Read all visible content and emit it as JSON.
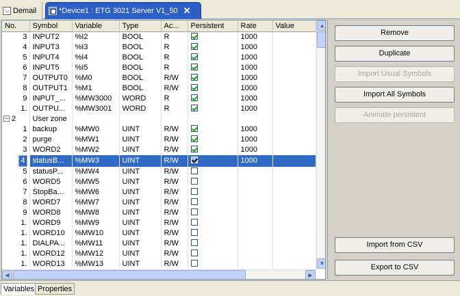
{
  "tabs": [
    {
      "label": "Demail",
      "icon": "mail-icon",
      "active": false
    },
    {
      "label": "*Device1 : ETG 3021 Server V1_50",
      "icon": "device-icon",
      "active": true
    }
  ],
  "table": {
    "headers": [
      "No.",
      "Symbol",
      "Variable",
      "Type",
      "Ac...",
      "Persistent",
      "Rate",
      "Value"
    ],
    "rows": [
      {
        "no": "3",
        "symbol": "INPUT2",
        "variable": "%I2",
        "type": "BOOL",
        "access": "R",
        "persistent": true,
        "rate": "1000",
        "value": ""
      },
      {
        "no": "4",
        "symbol": "INPUT3",
        "variable": "%I3",
        "type": "BOOL",
        "access": "R",
        "persistent": true,
        "rate": "1000",
        "value": ""
      },
      {
        "no": "5",
        "symbol": "INPUT4",
        "variable": "%I4",
        "type": "BOOL",
        "access": "R",
        "persistent": true,
        "rate": "1000",
        "value": ""
      },
      {
        "no": "6",
        "symbol": "INPUT5",
        "variable": "%I5",
        "type": "BOOL",
        "access": "R",
        "persistent": true,
        "rate": "1000",
        "value": ""
      },
      {
        "no": "7",
        "symbol": "OUTPUT0",
        "variable": "%M0",
        "type": "BOOL",
        "access": "R/W",
        "persistent": true,
        "rate": "1000",
        "value": ""
      },
      {
        "no": "8",
        "symbol": "OUTPUT1",
        "variable": "%M1",
        "type": "BOOL",
        "access": "R/W",
        "persistent": true,
        "rate": "1000",
        "value": ""
      },
      {
        "no": "9",
        "symbol": "INPUT_...",
        "variable": "%MW3000",
        "type": "WORD",
        "access": "R",
        "persistent": true,
        "rate": "1000",
        "value": ""
      },
      {
        "no": "1.",
        "symbol": "OUTPU...",
        "variable": "%MW3001",
        "type": "WORD",
        "access": "R",
        "persistent": true,
        "rate": "1000",
        "value": ""
      },
      {
        "group": true,
        "no": "2",
        "symbol": "User zone"
      },
      {
        "no": "1",
        "symbol": "backup",
        "variable": "%MW0",
        "type": "UINT",
        "access": "R/W",
        "persistent": true,
        "rate": "1000",
        "value": ""
      },
      {
        "no": "2",
        "symbol": "purge",
        "variable": "%MW1",
        "type": "UINT",
        "access": "R/W",
        "persistent": true,
        "rate": "1000",
        "value": ""
      },
      {
        "no": "3",
        "symbol": "WORD2",
        "variable": "%MW2",
        "type": "UINT",
        "access": "R/W",
        "persistent": true,
        "rate": "1000",
        "value": ""
      },
      {
        "no": "4",
        "symbol": "statusB...",
        "variable": "%MW3",
        "type": "UINT",
        "access": "R/W",
        "persistent": true,
        "rate": "1000",
        "value": "",
        "selected": true
      },
      {
        "no": "5",
        "symbol": "statusP...",
        "variable": "%MW4",
        "type": "UINT",
        "access": "R/W",
        "persistent": false,
        "rate": "",
        "value": ""
      },
      {
        "no": "6",
        "symbol": "WORD5",
        "variable": "%MW5",
        "type": "UINT",
        "access": "R/W",
        "persistent": false,
        "rate": "",
        "value": ""
      },
      {
        "no": "7",
        "symbol": "StopBa...",
        "variable": "%MW6",
        "type": "UINT",
        "access": "R/W",
        "persistent": false,
        "rate": "",
        "value": ""
      },
      {
        "no": "8",
        "symbol": "WORD7",
        "variable": "%MW7",
        "type": "UINT",
        "access": "R/W",
        "persistent": false,
        "rate": "",
        "value": ""
      },
      {
        "no": "9",
        "symbol": "WORD8",
        "variable": "%MW8",
        "type": "UINT",
        "access": "R/W",
        "persistent": false,
        "rate": "",
        "value": ""
      },
      {
        "no": "1.",
        "symbol": "WORD9",
        "variable": "%MW9",
        "type": "UINT",
        "access": "R/W",
        "persistent": false,
        "rate": "",
        "value": ""
      },
      {
        "no": "1.",
        "symbol": "WORD10",
        "variable": "%MW10",
        "type": "UINT",
        "access": "R/W",
        "persistent": false,
        "rate": "",
        "value": ""
      },
      {
        "no": "1.",
        "symbol": "DIALPA...",
        "variable": "%MW11",
        "type": "UINT",
        "access": "R/W",
        "persistent": false,
        "rate": "",
        "value": ""
      },
      {
        "no": "1.",
        "symbol": "WORD12",
        "variable": "%MW12",
        "type": "UINT",
        "access": "R/W",
        "persistent": false,
        "rate": "",
        "value": ""
      },
      {
        "no": "1.",
        "symbol": "WORD13",
        "variable": "%MW13",
        "type": "UINT",
        "access": "R/W",
        "persistent": false,
        "rate": "",
        "value": ""
      }
    ]
  },
  "buttons": {
    "remove": {
      "label": "Remove",
      "enabled": true
    },
    "duplicate": {
      "label": "Duplicate",
      "enabled": true
    },
    "import_usual": {
      "label": "Import Usual Symbols",
      "enabled": false
    },
    "import_all": {
      "label": "Import All Symbols",
      "enabled": true
    },
    "animate_persistent": {
      "label": "Animate persistent",
      "enabled": false
    },
    "import_csv": {
      "label": "Import from CSV",
      "enabled": true
    },
    "export_csv": {
      "label": "Export to CSV",
      "enabled": true
    }
  },
  "bottom_tabs": [
    {
      "label": "Variables",
      "active": true
    },
    {
      "label": "Properties",
      "active": false
    }
  ],
  "colors": {
    "selection": "#316ac5",
    "active_tab": "#2d5fc8",
    "check": "#21a121"
  }
}
